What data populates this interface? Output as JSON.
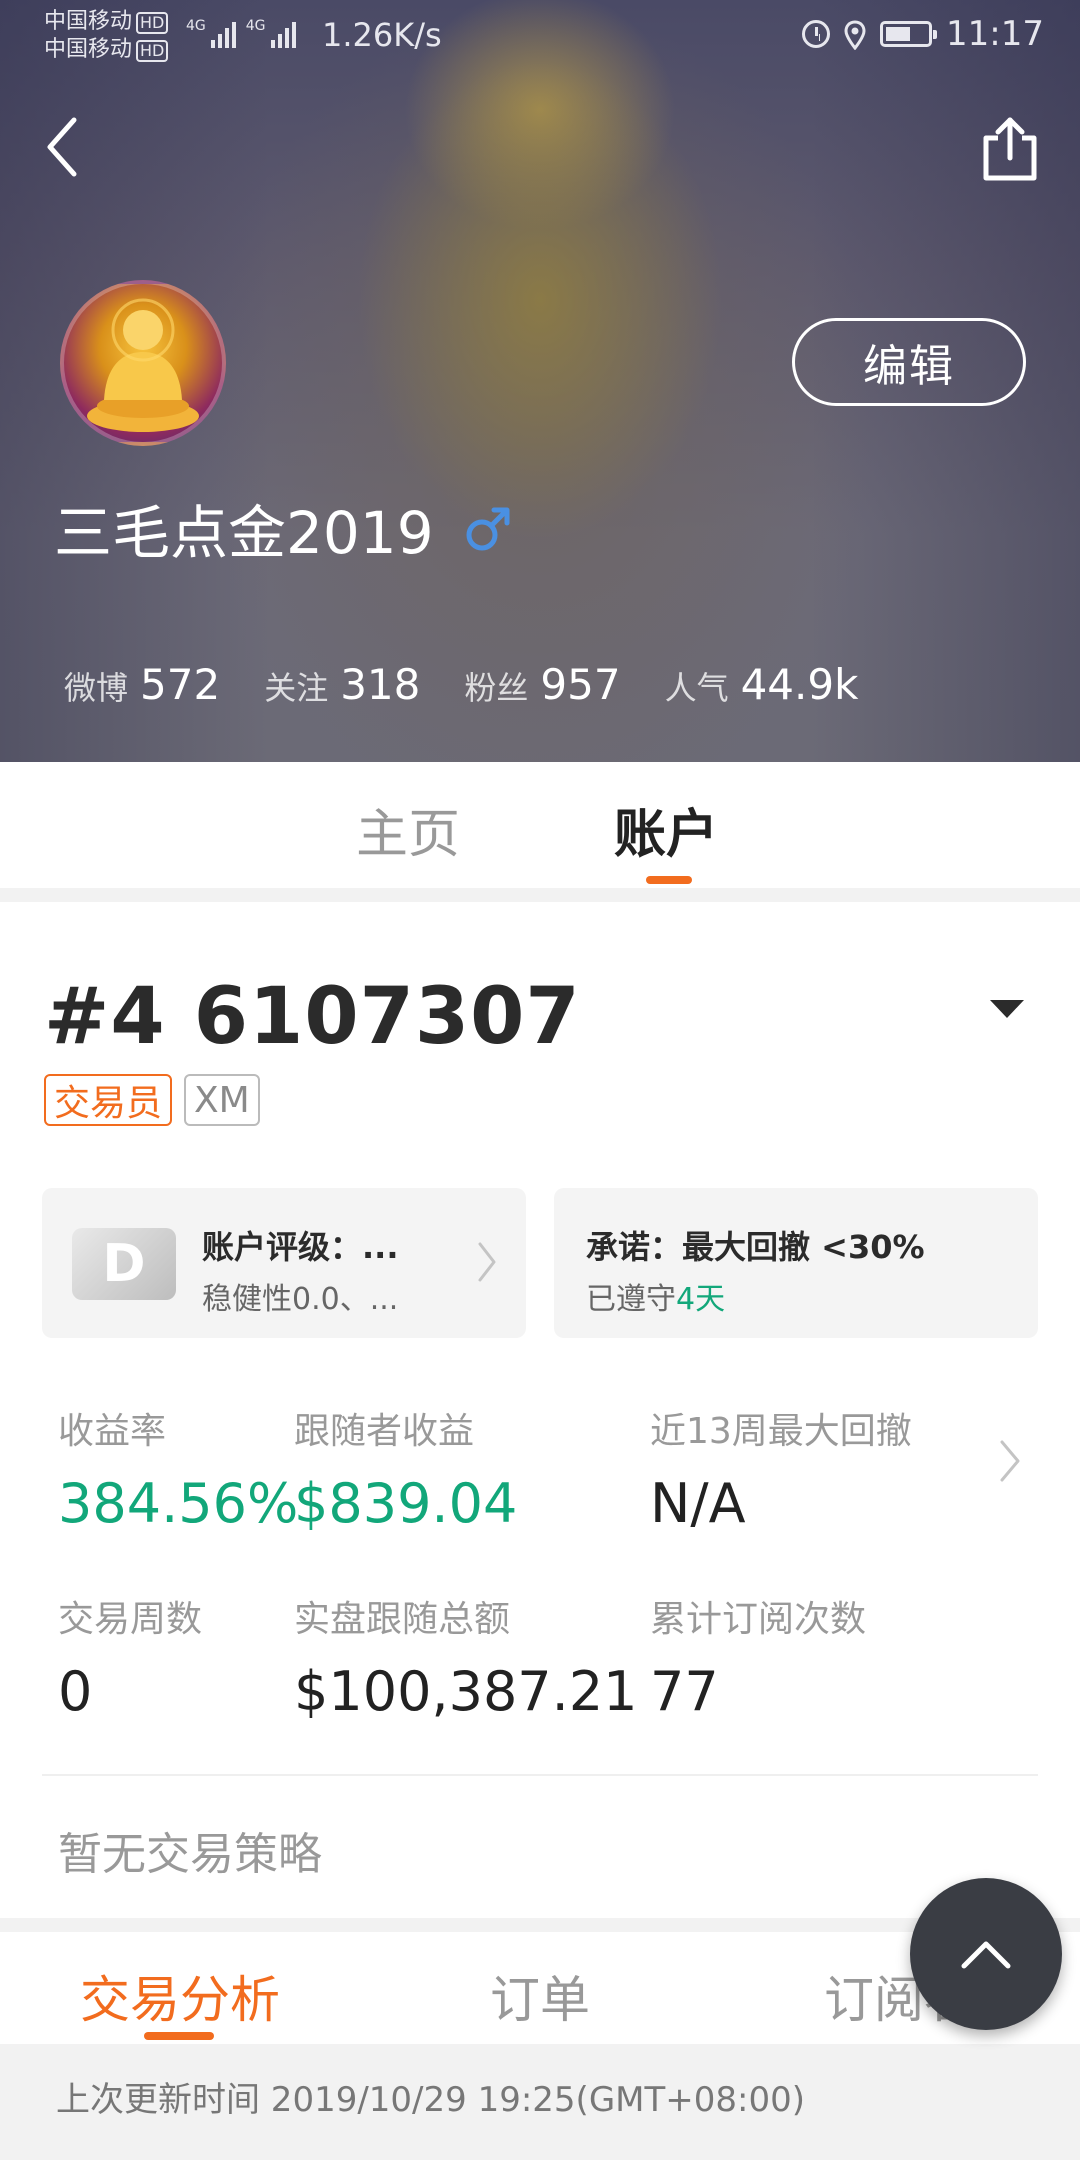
{
  "status_bar": {
    "carrier1": "中国移动",
    "carrier2": "中国移动",
    "hd": "HD",
    "net1": "4G",
    "net2": "4G",
    "speed": "1.26K/s",
    "time": "11:17",
    "icons": [
      "alarm-icon",
      "location-icon",
      "battery-icon"
    ]
  },
  "header": {
    "back_icon": "chevron-left-icon",
    "share_icon": "share-icon",
    "edit_label": "编辑",
    "username": "三毛点金2019",
    "gender_icon": "male-icon",
    "gender_color": "#4a90e2",
    "stats": [
      {
        "label": "微博",
        "value": "572"
      },
      {
        "label": "关注",
        "value": "318"
      },
      {
        "label": "粉丝",
        "value": "957"
      },
      {
        "label": "人气",
        "value": "44.9k"
      }
    ]
  },
  "tabs": [
    {
      "label": "主页",
      "active": false
    },
    {
      "label": "账户",
      "active": true
    }
  ],
  "account": {
    "number": "#4 6107307",
    "tag_trader": "交易员",
    "tag_broker": "XM",
    "rating_grade": "D",
    "rating_title": "账户评级：...",
    "rating_sub": "稳健性0.0、...",
    "promise_title": "承诺：最大回撤 <30%",
    "promise_sub_prefix": "已遵守",
    "promise_sub_days": "4天",
    "metrics": [
      {
        "label": "收益率",
        "value": "384.56%",
        "color": "#12a77a"
      },
      {
        "label": "跟随者收益",
        "value": "$839.04",
        "color": "#12a77a"
      },
      {
        "label": "近13周最大回撤",
        "value": "N/A"
      },
      {
        "label": "交易周数",
        "value": "0"
      },
      {
        "label": "实盘跟随总额",
        "value": "$100,387.21"
      },
      {
        "label": "累计订阅次数",
        "value": "77"
      }
    ],
    "no_strategy": "暂无交易策略"
  },
  "bottom_tabs": [
    {
      "label": "交易分析",
      "active": true
    },
    {
      "label": "订单",
      "active": false
    },
    {
      "label": "订阅者",
      "active": false
    }
  ],
  "update_time": "上次更新时间 2019/10/29 19:25(GMT+08:00)",
  "colors": {
    "accent": "#f26c1e",
    "positive": "#12a77a",
    "fab": "#3a3d44"
  }
}
